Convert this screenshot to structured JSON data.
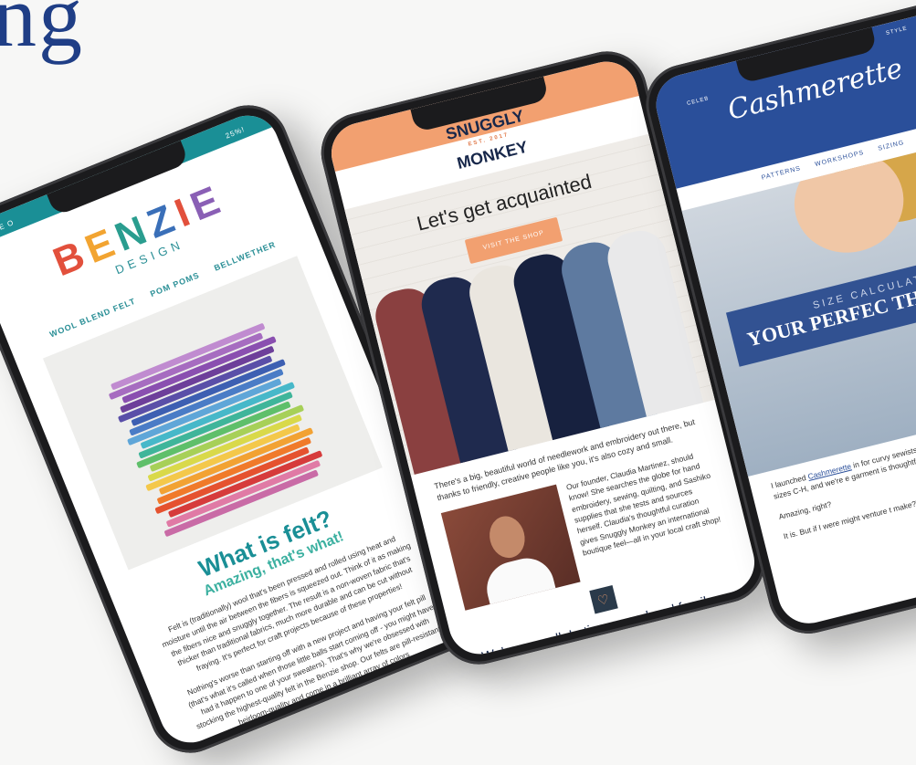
{
  "heading_fragment": "ng",
  "benzie": {
    "topbar_left": "WE O",
    "topbar_right": "25%!",
    "logo_letters": [
      "B",
      "E",
      "N",
      "Z",
      "I",
      "E"
    ],
    "logo_sub": "DESIGN",
    "nav": [
      "WOOL BLEND FELT",
      "POM POMS",
      "BELLWETHER"
    ],
    "heading": "What is felt?",
    "subheading": "Amazing, that's what!",
    "paragraph1": "Felt is (traditionally) wool that's been pressed and rolled using heat and moisture until the air between the fibers is squeezed out. Think of it as making the fibers nice and snuggly together. The result is a non-woven fabric that's thicker than traditional fabrics, much more durable and can be cut without fraying. It's perfect for craft projects because of these properties!",
    "paragraph2": "Nothing's worse than starting off with a new project and having your felt pill (that's what it's called when those little balls start coming off - you might have had it happen to one of your sweaters). That's why we're obsessed with stocking the highest-quality felt in the Benzie shop. Our felts are pill-resistant, heirloom-quality and come in a brilliant array of colors"
  },
  "snuggly": {
    "logo_line1": "SNUGGLY",
    "logo_est": "EST. 2017",
    "logo_line2": "MONKEY",
    "hero_heading": "Let's get acquainted",
    "visit_button": "VISIT THE SHOP",
    "intro": "There's a big, beautiful world of needlework and embroidery out there, but thanks to friendly, creative people like you, it's also cozy and small.",
    "founder": "Our founder, Claudia Martinez, should know! She searches the globe for hand embroidery, sewing, quilting, and Sashiko supplies that she tests and sources herself. Claudia's thoughtful curation gives Snuggly Monkey an international boutique feel—all in your local craft shop!",
    "tagline": "We're a small, Latina-owned and family-run business that's all about helping the crafting community thrive."
  },
  "cashmerette": {
    "top_left": "CELEB",
    "top_right": "STYLE",
    "logo": "Cashmerette",
    "nav": [
      "PATTERNS",
      "WORKSHOPS",
      "SIZING"
    ],
    "banner_small": "SIZE CALCULAT",
    "banner_big": "YOUR PERFEC THE FIRST",
    "para_prefix": "I launched",
    "para_link": "Cashmerette",
    "para_rest": "in for curvy sewists—finally, Cashmerette patterns ar sizes C-H, and we're e garment is thoughtful comfortable—why b",
    "para2": "Amazing, right?",
    "para3": "It is. But if I were might venture t make?\" Good"
  }
}
